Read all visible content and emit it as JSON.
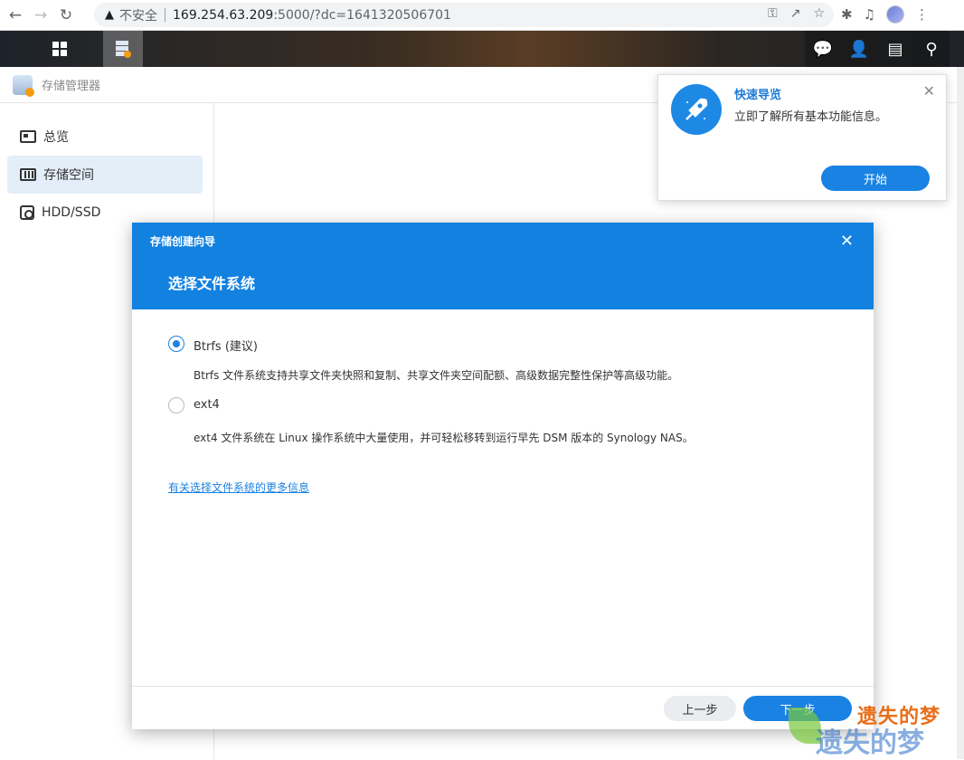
{
  "browser": {
    "insecure_label": "不安全",
    "url_host": "169.254.63.209",
    "url_rest": ":5000/?dc=1641320506701"
  },
  "app": {
    "title": "存储管理器"
  },
  "sidebar": {
    "items": [
      {
        "label": "总览",
        "icon": "overview-icon",
        "selected": false
      },
      {
        "label": "存储空间",
        "icon": "storage-pool-icon",
        "selected": true
      },
      {
        "label": "HDD/SSD",
        "icon": "hdd-icon",
        "selected": false
      }
    ]
  },
  "tour": {
    "title": "快速导览",
    "description": "立即了解所有基本功能信息。",
    "start_label": "开始"
  },
  "wizard": {
    "title": "存储创建向导",
    "step_title": "选择文件系统",
    "options": [
      {
        "label": "Btrfs (建议)",
        "description": "Btrfs 文件系统支持共享文件夹快照和复制、共享文件夹空间配额、高级数据完整性保护等高级功能。",
        "checked": true
      },
      {
        "label": "ext4",
        "description": "ext4 文件系统在 Linux 操作系统中大量使用，并可轻松移转到运行早先 DSM 版本的 Synology NAS。",
        "checked": false
      }
    ],
    "more_info_link": "有关选择文件系统的更多信息",
    "prev_label": "上一步",
    "next_label": "下一步"
  },
  "watermark": {
    "text1": "遗失的梦",
    "text2": "遗失的梦"
  },
  "colors": {
    "accent": "#1281e0",
    "button_blue": "#1a82e2",
    "sidebar_selected": "#e4eef9"
  }
}
